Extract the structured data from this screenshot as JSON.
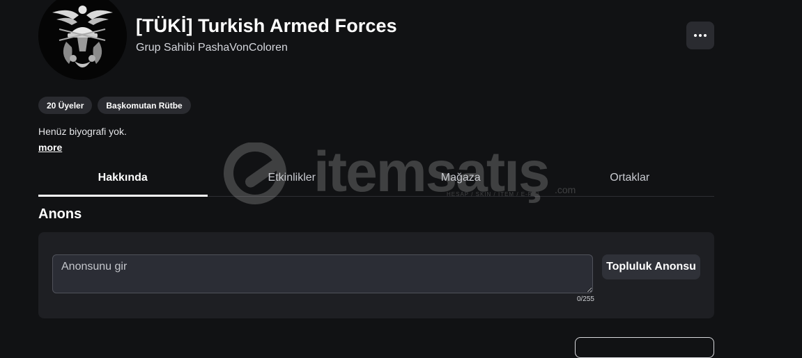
{
  "group": {
    "title": "[TÜKİ] Turkish Armed Forces",
    "owner_line": "Grup Sahibi PashaVonColoren",
    "avatar_icon": "military-emblem"
  },
  "chips": [
    {
      "label": "20 Üyeler"
    },
    {
      "label": "Başkomutan Rütbe"
    }
  ],
  "bio": {
    "text": "Henüz biyografi yok.",
    "more_label": "more"
  },
  "tabs": [
    {
      "label": "Hakkında",
      "active": true
    },
    {
      "label": "Etkinlikler",
      "active": false
    },
    {
      "label": "Mağaza",
      "active": false
    },
    {
      "label": "Ortaklar",
      "active": false
    }
  ],
  "announcement": {
    "section_title": "Anons",
    "placeholder": "Anonsunu gir",
    "value": "",
    "counter": "0/255",
    "button_label": "Topluluk Anonsu"
  },
  "watermark": {
    "text": "itemsatış",
    "domain": ".com",
    "tagline": "HESAP / SKIN / ITEM / E-PIN"
  },
  "colors": {
    "background": "#111214",
    "panel": "#1e1f23",
    "chip": "#2a2b30",
    "text": "#ffffff"
  }
}
